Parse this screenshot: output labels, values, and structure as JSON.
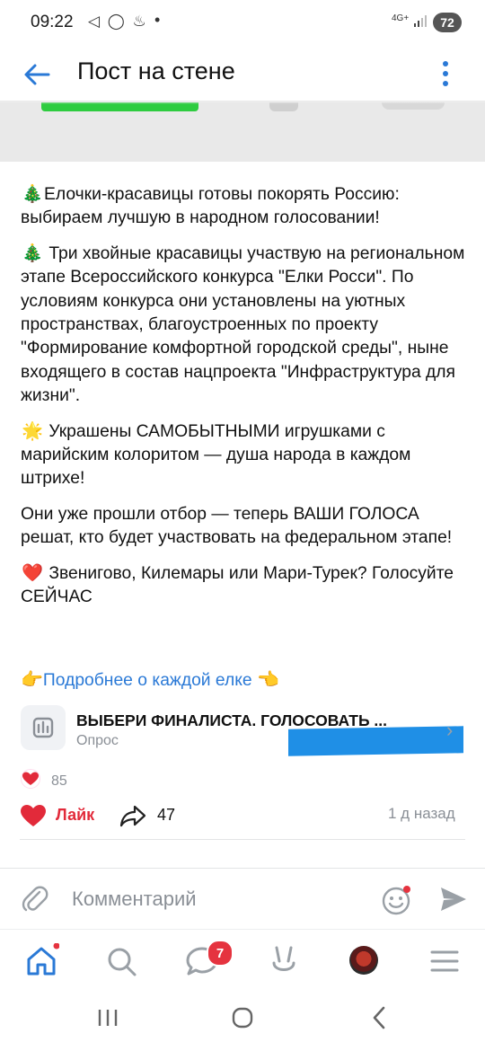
{
  "status_bar": {
    "time": "09:22",
    "notif_icons": "◁ ◯ ♨",
    "dot": "•",
    "network": "4G+",
    "battery": "72"
  },
  "header": {
    "title": "Пост на стене"
  },
  "post": {
    "paragraphs": [
      {
        "emoji": "🎄",
        "text": "Елочки-красавицы готовы покорять Россию: выбираем лучшую в народном голосовании!"
      },
      {
        "emoji": "🎄",
        "text": " Три хвойные красавицы участвую на региональном этапе Всероссийского конкурса \"Елки Росси\". По условиям конкурса они установлены на уютных пространствах, благоустроенных по проекту \"Формирование комфортной городской среды\", ныне входящего в состав нацпроекта \"Инфраструктура для жизни\"."
      },
      {
        "emoji": "🌟",
        "text": " Украшены САМОБЫТНЫМИ игрушками с марийским колоритом — душа народа в каждом штрихе!"
      },
      {
        "emoji": "",
        "text": "Они уже прошли отбор — теперь ВАШИ ГОЛОСА решат, кто будет участвовать на федеральном этапе!"
      },
      {
        "emoji": "❤️",
        "text": " Звенигово, Килемары или Мари-Турек? Голосуйте СЕЙЧАС"
      }
    ],
    "link_left_emoji": "👉",
    "link_text": "Подробнее о каждой елке",
    "link_right_emoji": "👈",
    "poll": {
      "title": "ВЫБЕРИ ФИНАЛИСТА. ГОЛОСОВАТЬ ...",
      "subtitle": "Опрос"
    },
    "reactions_count": "85",
    "like_label": "Лайк",
    "share_count": "47",
    "time": "1 д назад"
  },
  "comment": {
    "placeholder": "Комментарий"
  },
  "nav": {
    "messages_badge": "7"
  },
  "colors": {
    "accent": "#2a79d6",
    "like_red": "#e22a3a",
    "badge_red": "#e5333f"
  }
}
